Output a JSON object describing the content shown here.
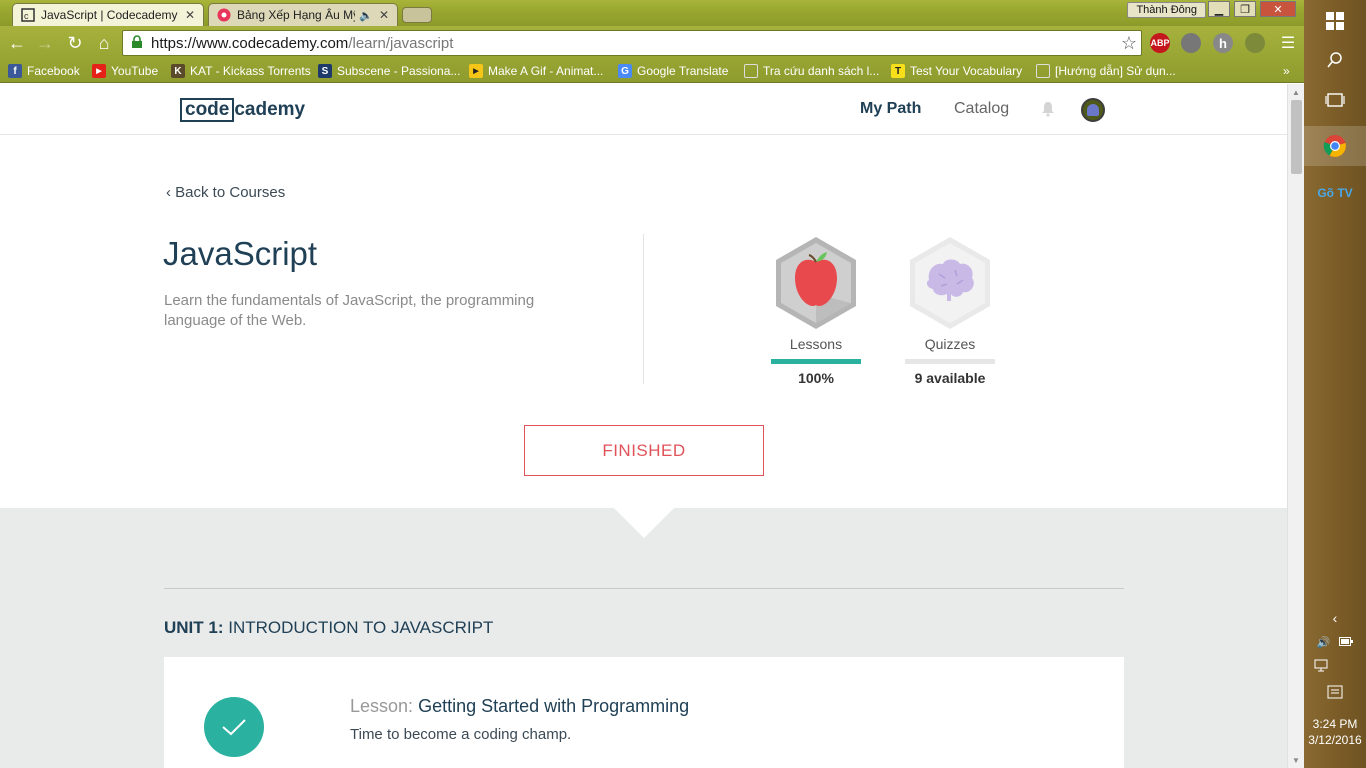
{
  "browser": {
    "tabs": [
      {
        "title": "JavaScript | Codecademy",
        "active": true
      },
      {
        "title": "Bảng Xếp Hạng Âu Mỹ",
        "active": false
      }
    ],
    "profile_name": "Thành Đông",
    "url_host": "https://www.codecademy.com",
    "url_path": "/learn/javascript",
    "extensions": [
      "ABP",
      "",
      "h",
      ""
    ],
    "bookmarks": [
      {
        "label": "Facebook",
        "icon": "f"
      },
      {
        "label": "YouTube",
        "icon": "▶"
      },
      {
        "label": "KAT - Kickass Torrents",
        "icon": "K"
      },
      {
        "label": "Subscene - Passiona...",
        "icon": "S"
      },
      {
        "label": "Make A Gif - Animat...",
        "icon": "▶"
      },
      {
        "label": "Google Translate",
        "icon": "G"
      },
      {
        "label": "Tra cứu danh sách l...",
        "icon": ""
      },
      {
        "label": "Test Your Vocabulary",
        "icon": "T"
      },
      {
        "label": "[Hướng dẫn] Sử dụn...",
        "icon": ""
      }
    ],
    "more_bookmarks": "»"
  },
  "site": {
    "logo_boxed": "code",
    "logo_rest": "cademy",
    "nav": {
      "my_path": "My Path",
      "catalog": "Catalog"
    }
  },
  "course": {
    "back_link": "Back to Courses",
    "title": "JavaScript",
    "description": "Learn the fundamentals of JavaScript, the programming language of the Web.",
    "lessons_label": "Lessons",
    "lessons_value": "100%",
    "lessons_progress": 1.0,
    "quizzes_label": "Quizzes",
    "quizzes_value": "9 available",
    "status_button": "FINISHED"
  },
  "unit": {
    "number_label": "UNIT 1:",
    "name": "INTRODUCTION TO JAVASCRIPT",
    "lesson": {
      "kind": "Lesson:",
      "title": "Getting Started with Programming",
      "subtitle": "Time to become a coding champ."
    }
  },
  "taskbar": {
    "time": "3:24 PM",
    "date": "3/12/2016",
    "goTV_label": "Gõ TV"
  },
  "colors": {
    "teal": "#2bb1a0",
    "navy": "#204056",
    "finished_red": "#e0525a"
  }
}
